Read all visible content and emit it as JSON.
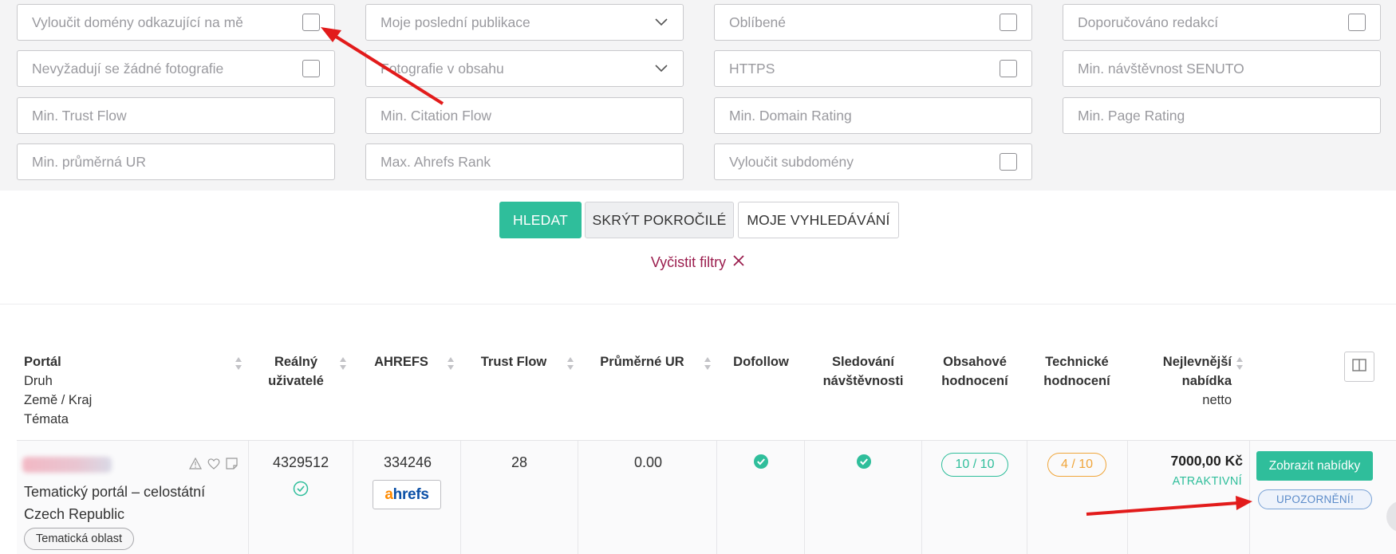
{
  "filters": {
    "exclude_referring": "Vyloučit domény odkazující na mě",
    "my_last_publications": "Moje poslední publikace",
    "favorites": "Oblíbené",
    "editor_recommended": "Doporučováno redakcí",
    "no_photos_required": "Nevyžadují se žádné fotografie",
    "photos_in_content": "Fotografie v obsahu",
    "https": "HTTPS",
    "min_senuto": "Min. návštěvnost SENUTO",
    "min_trust_flow": "Min. Trust Flow",
    "min_citation_flow": "Min. Citation Flow",
    "min_domain_rating": "Min. Domain Rating",
    "min_page_rating": "Min. Page Rating",
    "min_avg_ur": "Min. průměrná UR",
    "max_ahrefs_rank": "Max. Ahrefs Rank",
    "exclude_subdomains": "Vyloučit subdomény"
  },
  "actions": {
    "search": "HLEDAT",
    "hide_advanced": "SKRÝT POKROČILÉ",
    "my_searches": "MOJE VYHLEDÁVÁNÍ",
    "clear_filters": "Vyčistit filtry"
  },
  "table": {
    "headers": {
      "portal": "Portál",
      "type": "Druh",
      "country": "Země / Kraj",
      "topics": "Témata",
      "real_users_1": "Reálný",
      "real_users_2": "uživatelé",
      "ahrefs": "AHREFS",
      "trust_flow": "Trust Flow",
      "avg_ur": "Průměrné UR",
      "dofollow": "Dofollow",
      "tracking_1": "Sledování",
      "tracking_2": "návštěvnosti",
      "content_1": "Obsahové",
      "content_2": "hodnocení",
      "tech_1": "Technické",
      "tech_2": "hodnocení",
      "cheapest_1": "Nejlevnější",
      "cheapest_2": "nabídka",
      "cheapest_3": "netto"
    },
    "row": {
      "type": "Tematický portál – celostátní",
      "country": "Czech Republic",
      "topic_tag": "Tematická oblast",
      "real_users": "4329512",
      "ahrefs": "334246",
      "ahrefs_logo_1": "a",
      "ahrefs_logo_2": "hrefs",
      "trust_flow": "28",
      "avg_ur": "0.00",
      "content_rating": "10 / 10",
      "tech_rating": "4 / 10",
      "price": "7000,00 Kč",
      "price_label": "ATRAKTIVNÍ",
      "show_offers": "Zobrazit nabídky",
      "warning": "UPOZORNĚNÍ!"
    }
  },
  "colors": {
    "accent": "#2fbe9b",
    "clear_filters": "#9b1e4e",
    "annotation_arrow": "#e21b1b",
    "rating_orange": "#f0a53a"
  }
}
